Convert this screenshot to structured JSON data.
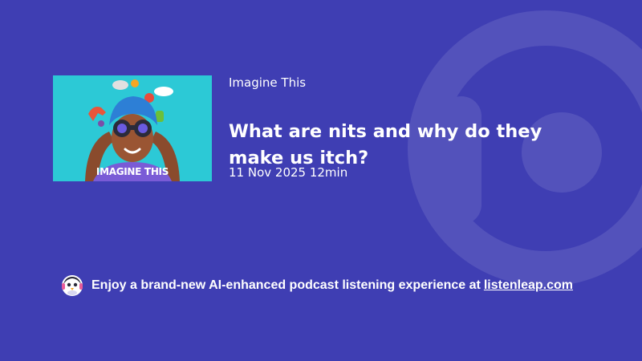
{
  "podcast": {
    "show_name": "Imagine This",
    "cover_title": "IMAGINE THIS",
    "cover_bg_color": "#2cc9d6"
  },
  "episode": {
    "title": "What are nits and why do they make us itch?",
    "date": "11 Nov 2025",
    "duration": "12min",
    "meta": "11 Nov 2025 12min"
  },
  "promo": {
    "text": "Enjoy a brand-new AI-enhanced podcast listening experience at",
    "link_text": "listenleap.com",
    "icon": "penguin-logo-icon"
  },
  "theme": {
    "background": "#3f3eb3",
    "text": "#ffffff"
  }
}
